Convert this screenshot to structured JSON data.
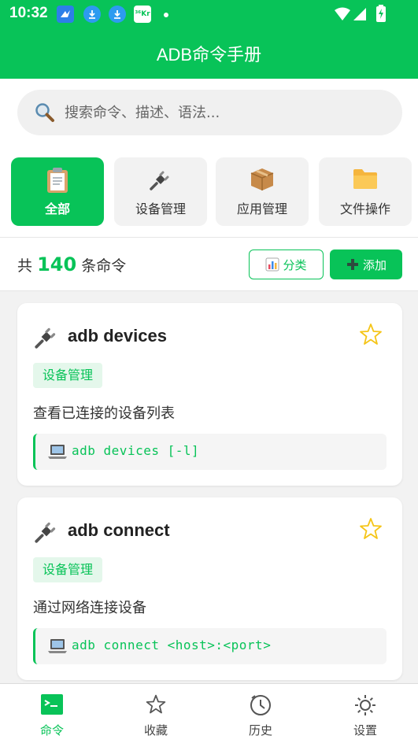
{
  "status_bar": {
    "time": "10:32",
    "notification_icons": [
      "bird-icon",
      "download-icon",
      "download-icon",
      "36kr-icon"
    ],
    "kr_badge": "³⁶Kr"
  },
  "header": {
    "title": "ADB命令手册",
    "color": "#08c358"
  },
  "search": {
    "placeholder": "搜索命令、描述、语法..."
  },
  "categories": [
    {
      "label": "全部",
      "icon": "clipboard-icon",
      "active": true
    },
    {
      "label": "设备管理",
      "icon": "plug-icon",
      "active": false
    },
    {
      "label": "应用管理",
      "icon": "package-icon",
      "active": false
    },
    {
      "label": "文件操作",
      "icon": "folder-icon",
      "active": false
    }
  ],
  "summary": {
    "prefix": "共",
    "count": "140",
    "suffix": "条命令",
    "category_button": "分类",
    "add_button": "添加"
  },
  "commands": [
    {
      "title": "adb devices",
      "tag": "设备管理",
      "description": "查看已连接的设备列表",
      "syntax": "adb devices [-l]",
      "favorited": false
    },
    {
      "title": "adb connect",
      "tag": "设备管理",
      "description": "通过网络连接设备",
      "syntax": "adb connect <host>:<port>",
      "favorited": false
    }
  ],
  "bottom_nav": [
    {
      "label": "命令",
      "icon": "terminal-icon",
      "active": true
    },
    {
      "label": "收藏",
      "icon": "star-outline-icon",
      "active": false
    },
    {
      "label": "历史",
      "icon": "clock-icon",
      "active": false
    },
    {
      "label": "设置",
      "icon": "sun-settings-icon",
      "active": false
    }
  ]
}
